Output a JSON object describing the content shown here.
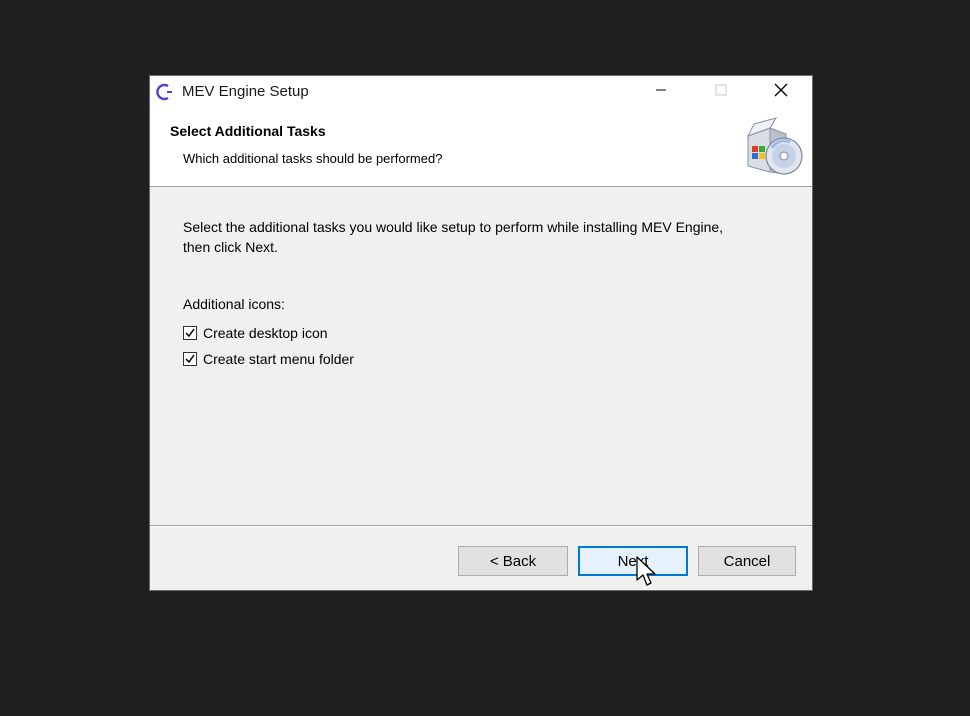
{
  "window": {
    "title": "MEV Engine Setup",
    "app_icon": "mev-engine-icon",
    "controls": {
      "minimize": "minimize-icon",
      "maximize": "maximize-icon",
      "close": "close-icon"
    }
  },
  "header": {
    "title": "Select Additional Tasks",
    "subtitle": "Which additional tasks should be performed?",
    "icon": "setup-box-icon"
  },
  "content": {
    "instruction": "Select the additional tasks you would like setup to perform while installing MEV Engine, then click Next.",
    "group_label": "Additional icons:",
    "tasks": [
      {
        "label": "Create desktop icon",
        "checked": true
      },
      {
        "label": "Create start menu folder",
        "checked": true
      }
    ]
  },
  "footer": {
    "back_label": "< Back",
    "next_label": "Next",
    "cancel_label": "Cancel"
  },
  "colors": {
    "accent": "#0078d7",
    "backdrop": "#1f1f1f"
  }
}
